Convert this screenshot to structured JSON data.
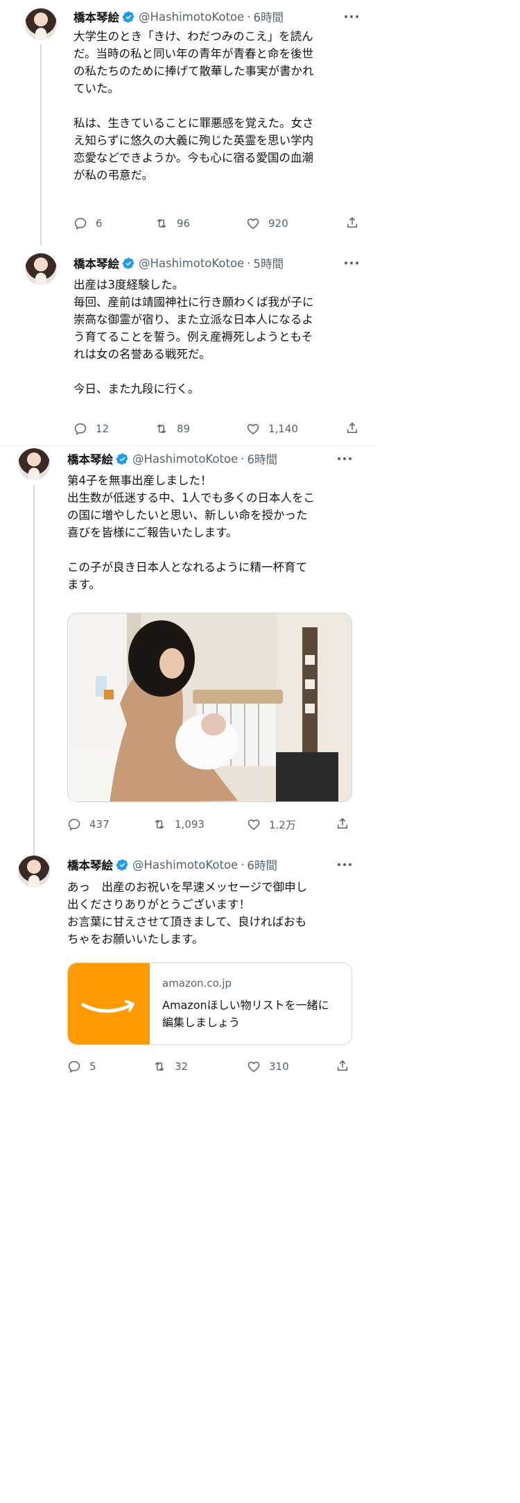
{
  "tweets": [
    {
      "name": "橋本琴絵",
      "handle": "@HashimotoKotoe",
      "separator": "·",
      "time": "6時間",
      "text": [
        "大学生のとき「きけ、わだつみのこえ」を読ん",
        "だ。当時の私と同い年の青年が青春と命を後世",
        "の私たちのために捧げて散華した事実が書かれ",
        "ていた。",
        "",
        "私は、生きていることに罪悪感を覚えた。女さ",
        "え知らずに悠久の大義に殉じた英霊を思い学内",
        "恋愛などできようか。今も心に宿る愛国の血潮",
        "が私の弔意だ。"
      ],
      "replies": "6",
      "retweets": "96",
      "likes": "920"
    },
    {
      "name": "橋本琴絵",
      "handle": "@HashimotoKotoe",
      "separator": "·",
      "time": "5時間",
      "text": [
        "出産は3度経験した。",
        "毎回、産前は靖國神社に行き願わくば我が子に",
        "崇高な御霊が宿り、また立派な日本人になるよ",
        "う育てることを誓う。例え産褥死しようともそ",
        "れは女の名誉ある戦死だ。",
        "",
        "今日、また九段に行く。"
      ],
      "replies": "12",
      "retweets": "89",
      "likes": "1,140"
    },
    {
      "name": "橋本琴絵",
      "handle": "@HashimotoKotoe",
      "separator": "·",
      "time": "6時間",
      "text": [
        "第4子を無事出産しました！",
        "出生数が低迷する中、1人でも多くの日本人をこ",
        "の国に増やしたいと思い、新しい命を授かった",
        "喜びを皆様にご報告いたします。",
        "",
        "この子が良き日本人となれるように精一杯育て",
        "ます。"
      ],
      "replies": "437",
      "retweets": "1,093",
      "likes": "1.2万"
    },
    {
      "name": "橋本琴絵",
      "handle": "@HashimotoKotoe",
      "separator": "·",
      "time": "6時間",
      "text": [
        "あっ　出産のお祝いを早速メッセージで御申し",
        "出くださりありがとうございます！",
        "お言葉に甘えさせて頂きまして、良ければおも",
        "ちゃをお願いいたします。"
      ],
      "replies": "5",
      "retweets": "32",
      "likes": "310"
    }
  ],
  "link_card": {
    "domain": "amazon.co.jp",
    "title": "Amazonほしい物リストを一緒に編集しましょう"
  },
  "icons": {
    "verified": "verified-badge-icon",
    "reply": "reply-icon",
    "retweet": "retweet-icon",
    "like": "heart-icon",
    "share": "share-icon",
    "more": "more-dots-icon"
  },
  "colors": {
    "verified": "#1d9bf0",
    "muted": "#536471",
    "text": "#0f1419",
    "amazon_orange": "#ff9a00"
  }
}
